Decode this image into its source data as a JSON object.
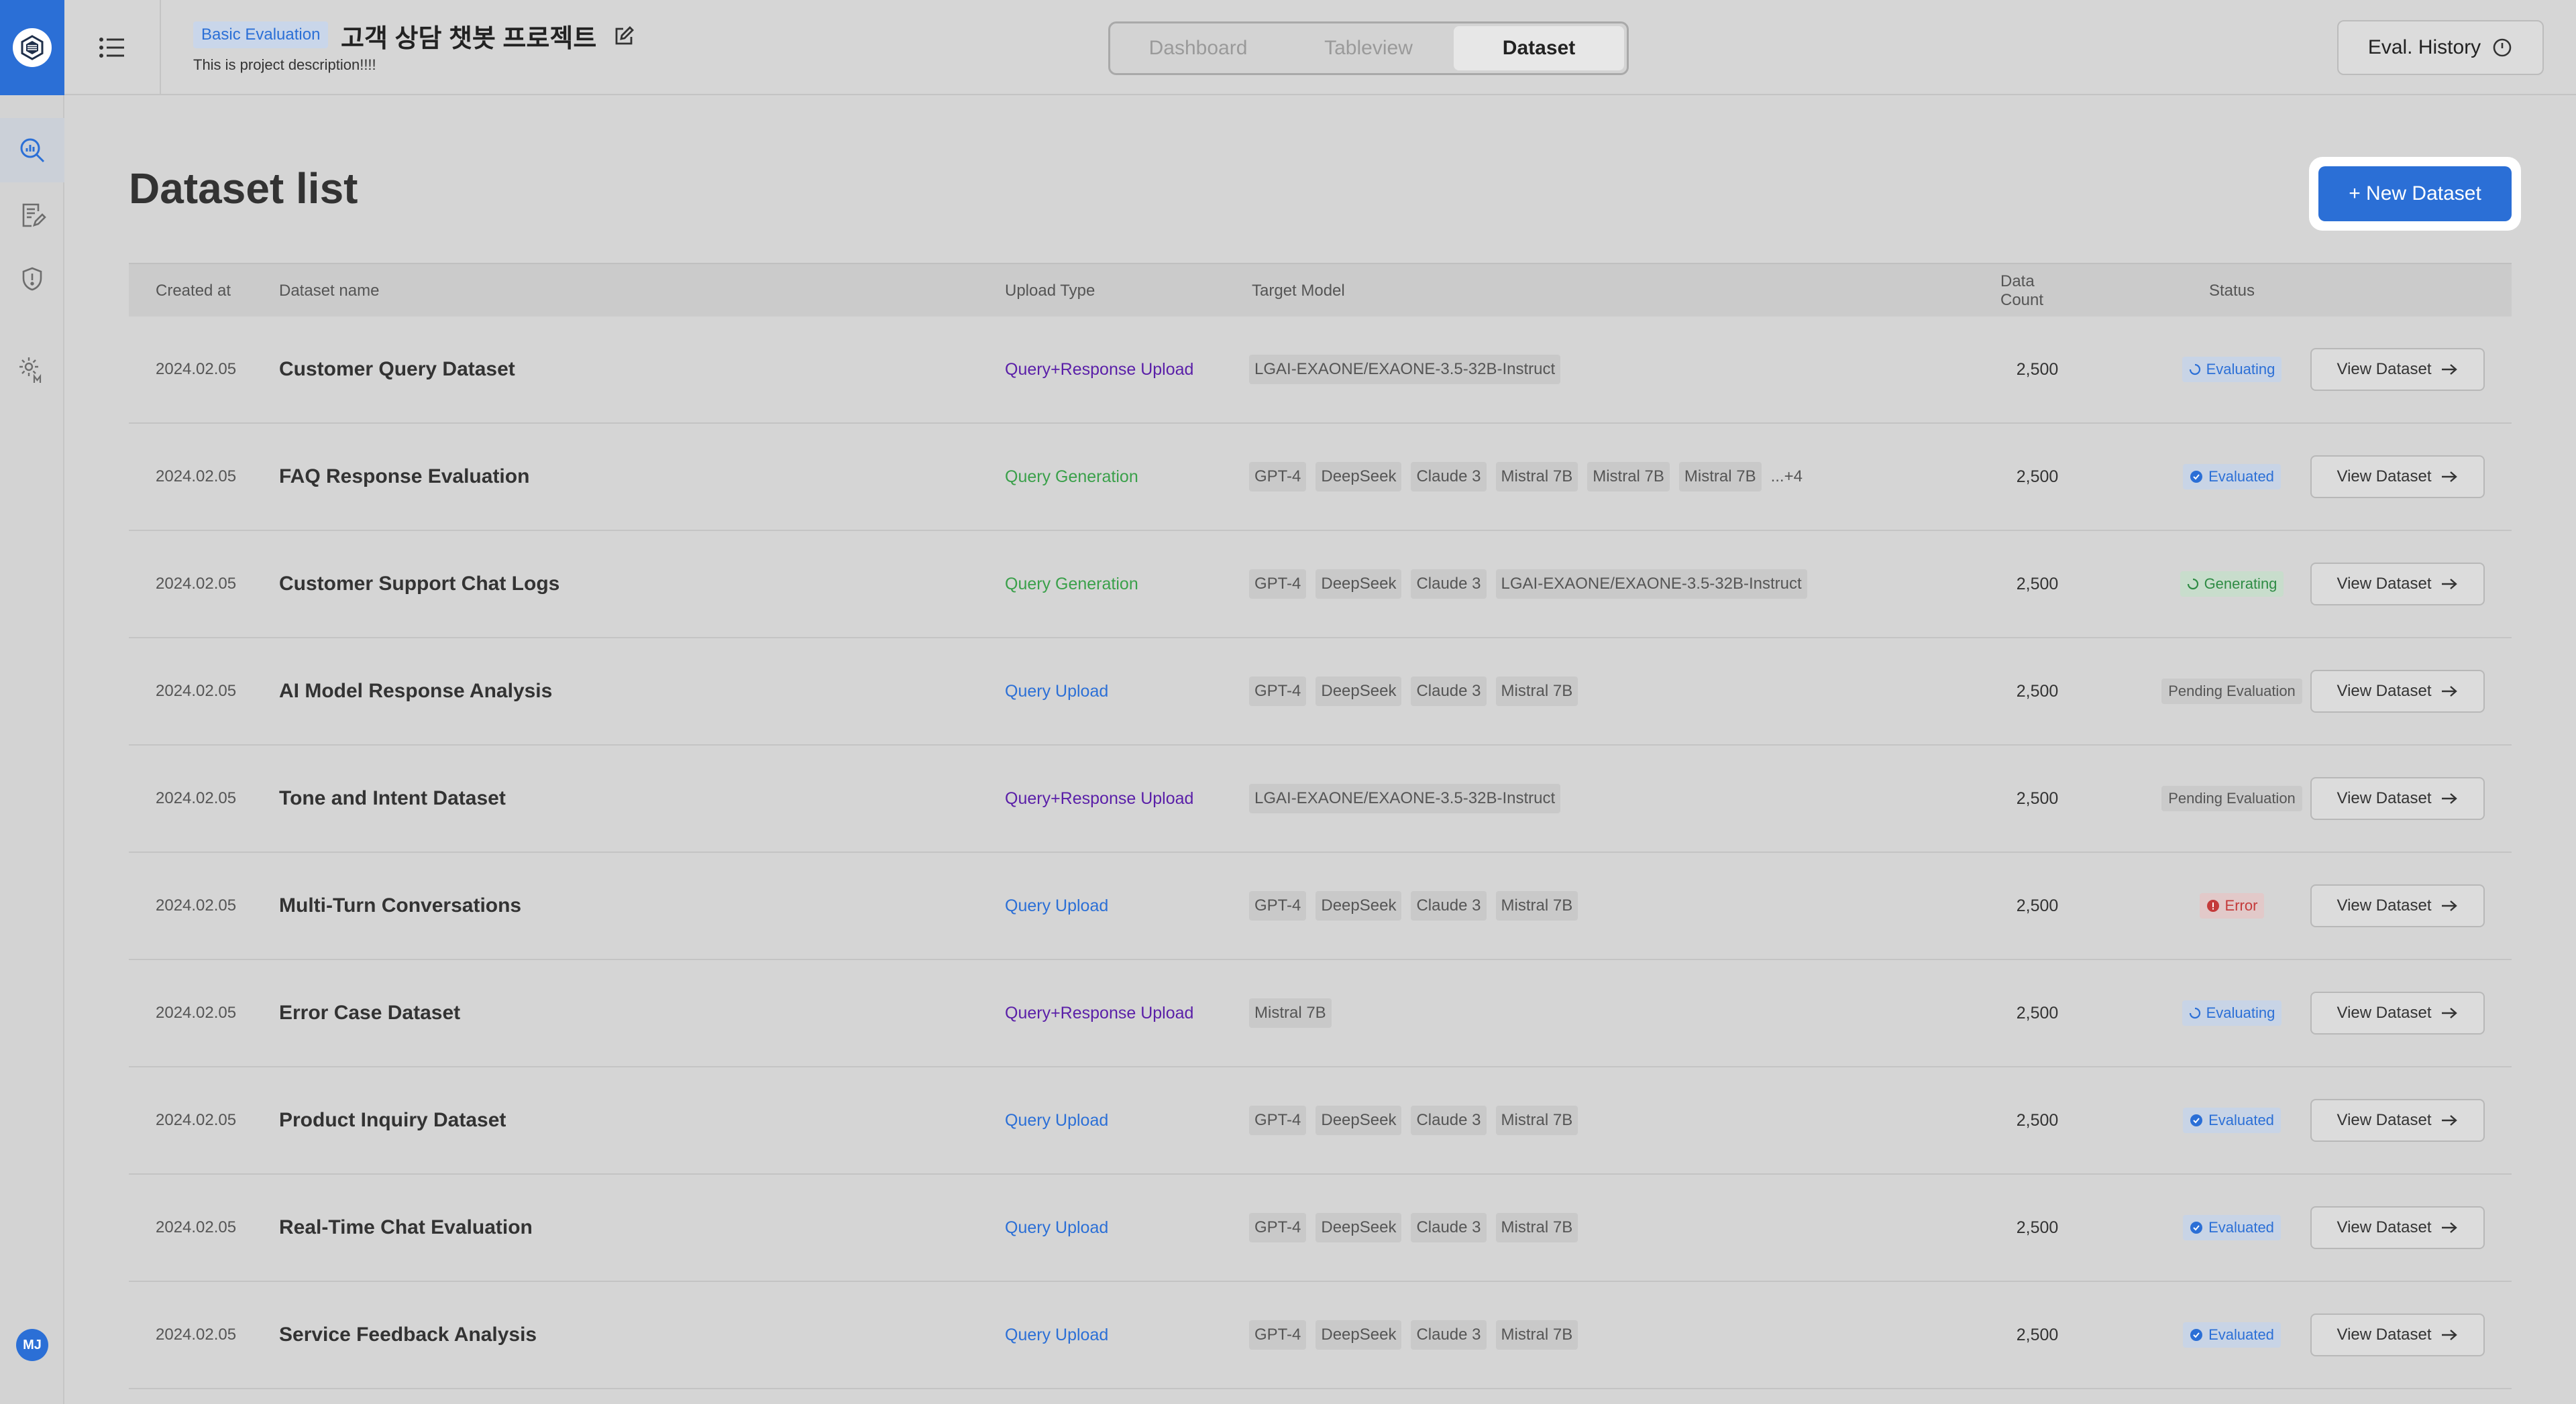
{
  "colors": {
    "accent": "#2b6fd6",
    "evaluated": "#2b6fd6",
    "generating": "#2e8b44",
    "error": "#c43a3a",
    "query_response": "#5a1fa8",
    "query_generation": "#3aa04a"
  },
  "sidebar": {
    "items": [
      {
        "icon": "analytics-search-icon"
      },
      {
        "icon": "document-edit-icon"
      },
      {
        "icon": "shield-alert-icon"
      },
      {
        "icon": "settings-m-icon"
      }
    ],
    "avatar_initials": "MJ"
  },
  "header": {
    "tag": "Basic Evaluation",
    "title": "고객 상담 챗봇 프로젝트",
    "description": "This is project description!!!!",
    "tabs": [
      {
        "label": "Dashboard",
        "active": false
      },
      {
        "label": "Tableview",
        "active": false
      },
      {
        "label": "Dataset",
        "active": true
      }
    ],
    "history_button": "Eval. History"
  },
  "main": {
    "title": "Dataset list",
    "new_button": "+ New Dataset",
    "columns": [
      "Created at",
      "Dataset name",
      "Upload Type",
      "Target Model",
      "Data Count",
      "Status"
    ],
    "view_label": "View Dataset",
    "rows": [
      {
        "date": "2024.02.05",
        "name": "Customer Query Dataset",
        "upload": "Query+Response Upload",
        "utype": "qr",
        "models": [
          "LGAI-EXAONE/EXAONE-3.5-32B-Instruct"
        ],
        "more": "",
        "count": "2,500",
        "status": "Evaluating",
        "stype": "evaluating"
      },
      {
        "date": "2024.02.05",
        "name": "FAQ Response Evaluation",
        "upload": "Query Generation",
        "utype": "gen",
        "models": [
          "GPT-4",
          "DeepSeek",
          "Claude 3",
          "Mistral 7B",
          "Mistral 7B",
          "Mistral 7B"
        ],
        "more": "...+4",
        "count": "2,500",
        "status": "Evaluated",
        "stype": "evaluated"
      },
      {
        "date": "2024.02.05",
        "name": "Customer Support Chat Logs",
        "upload": "Query Generation",
        "utype": "gen",
        "models": [
          "GPT-4",
          "DeepSeek",
          "Claude 3",
          "LGAI-EXAONE/EXAONE-3.5-32B-Instruct"
        ],
        "more": "",
        "count": "2,500",
        "status": "Generating",
        "stype": "generating"
      },
      {
        "date": "2024.02.05",
        "name": "AI Model Response Analysis",
        "upload": "Query Upload",
        "utype": "q",
        "models": [
          "GPT-4",
          "DeepSeek",
          "Claude 3",
          "Mistral 7B"
        ],
        "more": "",
        "count": "2,500",
        "status": "Pending Evaluation",
        "stype": "pending"
      },
      {
        "date": "2024.02.05",
        "name": "Tone and Intent Dataset",
        "upload": "Query+Response Upload",
        "utype": "qr",
        "models": [
          "LGAI-EXAONE/EXAONE-3.5-32B-Instruct"
        ],
        "more": "",
        "count": "2,500",
        "status": "Pending Evaluation",
        "stype": "pending"
      },
      {
        "date": "2024.02.05",
        "name": "Multi-Turn Conversations",
        "upload": "Query Upload",
        "utype": "q",
        "models": [
          "GPT-4",
          "DeepSeek",
          "Claude 3",
          "Mistral 7B"
        ],
        "more": "",
        "count": "2,500",
        "status": "Error",
        "stype": "error"
      },
      {
        "date": "2024.02.05",
        "name": "Error Case Dataset",
        "upload": "Query+Response Upload",
        "utype": "qr",
        "models": [
          "Mistral 7B"
        ],
        "more": "",
        "count": "2,500",
        "status": "Evaluating",
        "stype": "evaluating"
      },
      {
        "date": "2024.02.05",
        "name": "Product Inquiry Dataset",
        "upload": "Query Upload",
        "utype": "q",
        "models": [
          "GPT-4",
          "DeepSeek",
          "Claude 3",
          "Mistral 7B"
        ],
        "more": "",
        "count": "2,500",
        "status": "Evaluated",
        "stype": "evaluated"
      },
      {
        "date": "2024.02.05",
        "name": "Real-Time Chat Evaluation",
        "upload": "Query Upload",
        "utype": "q",
        "models": [
          "GPT-4",
          "DeepSeek",
          "Claude 3",
          "Mistral 7B"
        ],
        "more": "",
        "count": "2,500",
        "status": "Evaluated",
        "stype": "evaluated"
      },
      {
        "date": "2024.02.05",
        "name": "Service Feedback Analysis",
        "upload": "Query Upload",
        "utype": "q",
        "models": [
          "GPT-4",
          "DeepSeek",
          "Claude 3",
          "Mistral 7B"
        ],
        "more": "",
        "count": "2,500",
        "status": "Evaluated",
        "stype": "evaluated"
      }
    ]
  }
}
